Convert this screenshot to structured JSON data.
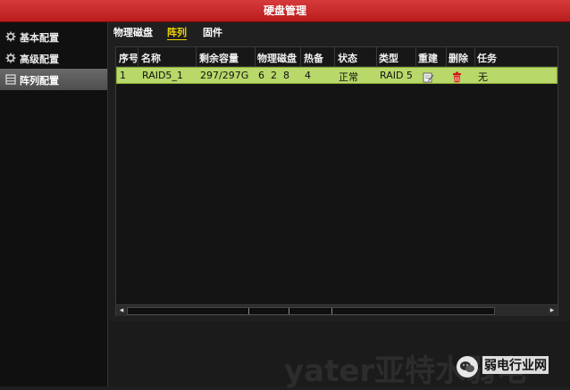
{
  "window": {
    "title": "硬盘管理"
  },
  "sidebar": {
    "items": [
      {
        "label": "基本配置",
        "icon": "gear-icon"
      },
      {
        "label": "高级配置",
        "icon": "gear-icon"
      },
      {
        "label": "阵列配置",
        "icon": "array-icon",
        "active": true
      }
    ]
  },
  "tabs": [
    {
      "label": "物理磁盘"
    },
    {
      "label": "阵列",
      "active": true
    },
    {
      "label": "固件"
    }
  ],
  "table": {
    "headers": [
      "序号",
      "名称",
      "剩余容量",
      "物理磁盘",
      "热备",
      "状态",
      "类型",
      "重建",
      "删除",
      "任务"
    ],
    "rows": [
      {
        "index": "1",
        "name": "RAID5_1",
        "free": "297/297G",
        "disks": "6  2  8",
        "hotspare": "4",
        "status": "正常",
        "type": "RAID 5",
        "rebuild_icon": "edit-icon",
        "delete_icon": "trash-icon",
        "task": "无"
      }
    ]
  },
  "watermark": {
    "text": "yater亚特水弱电",
    "badge_text": "弱电行业网"
  },
  "colors": {
    "titlebar": "#c92a2a",
    "row_highlight": "#b8d86a",
    "active_tab": "#f1d300"
  }
}
